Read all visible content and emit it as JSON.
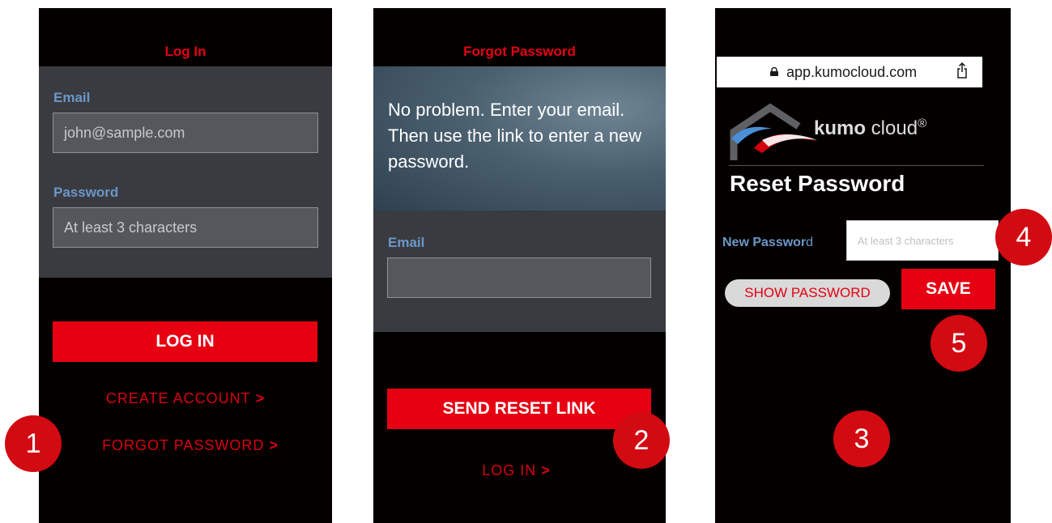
{
  "login": {
    "title": "Log In",
    "email_label": "Email",
    "email_value": "john@sample.com",
    "password_label": "Password",
    "password_placeholder": "At least 3 characters",
    "login_button": "LOG IN",
    "create_account_link": "CREATE ACCOUNT",
    "forgot_password_link": "FORGOT PASSWORD",
    "chevron": ">"
  },
  "forgot": {
    "title": "Forgot Password",
    "message": "No problem. Enter your email. Then use the link to enter a new password.",
    "email_label": "Email",
    "email_value": "",
    "send_button": "SEND RESET LINK",
    "login_link": "LOG IN",
    "chevron": ">"
  },
  "reset": {
    "url": "app.kumocloud.com",
    "brand_bold": "kumo",
    "brand_rest": " cloud",
    "brand_mark": "®",
    "title": "Reset Password",
    "new_password_label_bold": "New Passwor",
    "new_password_label_tail": "d",
    "new_password_placeholder": "At least 3 characters",
    "show_password_button": "SHOW PASSWORD",
    "save_button": "SAVE"
  },
  "badges": [
    "1",
    "2",
    "3",
    "4",
    "5"
  ],
  "colors": {
    "accent_red": "#e60012",
    "label_blue": "#6b97c9",
    "panel_gray": "#3a3b40",
    "screen_black": "#050000"
  }
}
